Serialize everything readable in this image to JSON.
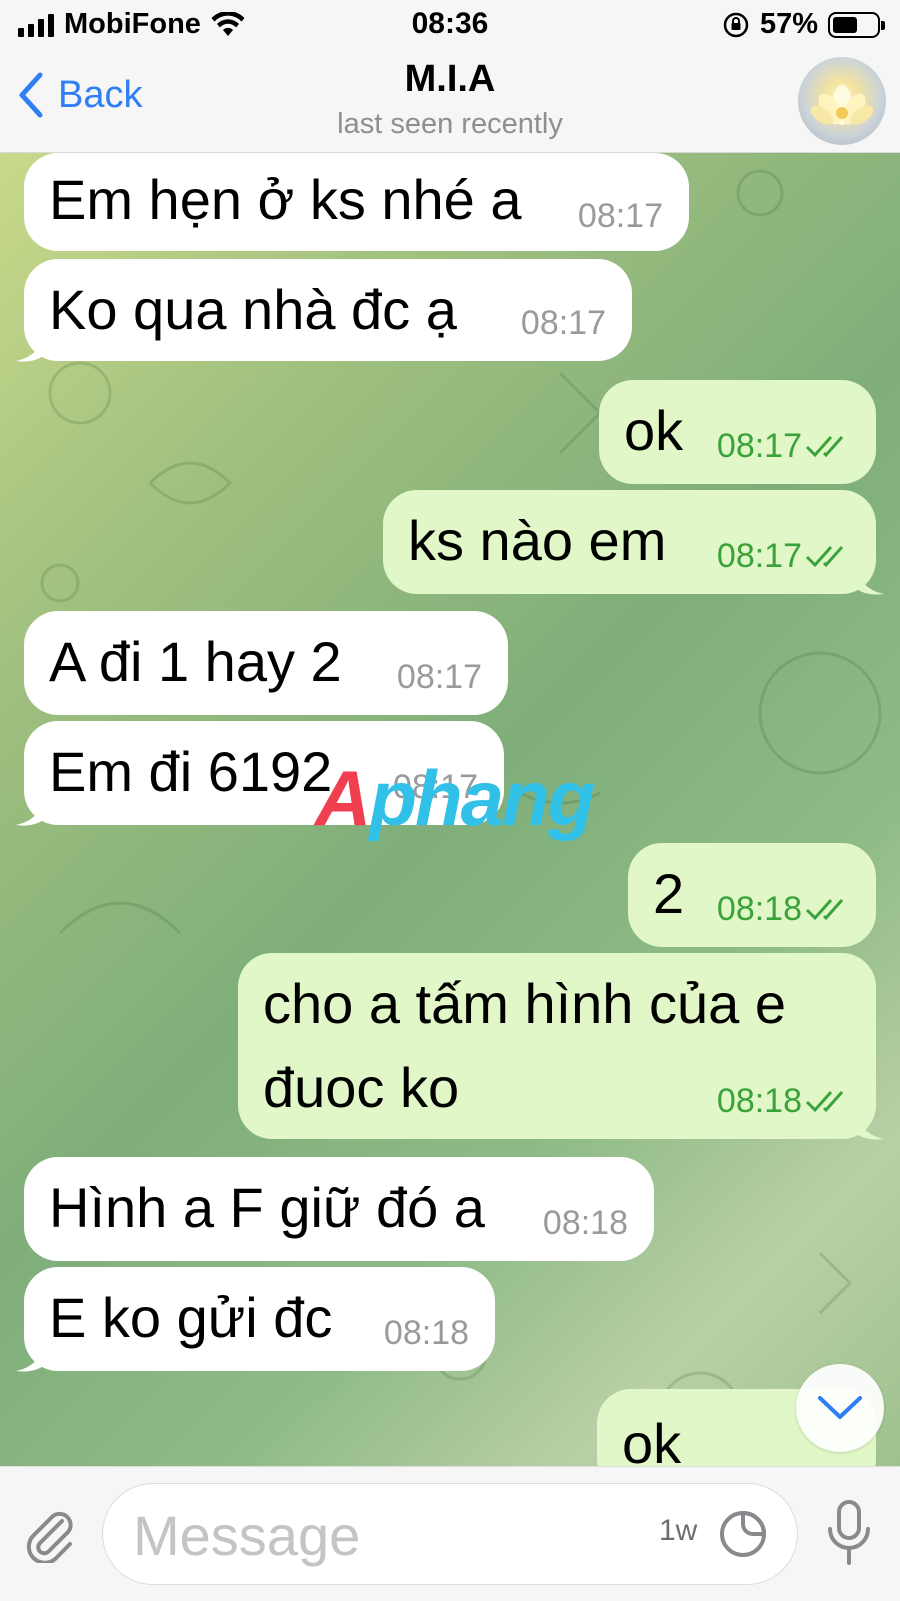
{
  "status_bar": {
    "carrier": "MobiFone",
    "time": "08:36",
    "battery": "57%",
    "battery_level": 0.57
  },
  "header": {
    "back_label": "Back",
    "title": "M.I.A",
    "subtitle": "last seen recently"
  },
  "messages": [
    {
      "dir": "in",
      "text": "Em hẹn ở ks nhé a",
      "time": "08:17"
    },
    {
      "dir": "in",
      "text": "Ko qua nhà đc ạ",
      "time": "08:17"
    },
    {
      "dir": "out",
      "text": "ok",
      "time": "08:17",
      "status": "read"
    },
    {
      "dir": "out",
      "text": "ks nào em",
      "time": "08:17",
      "status": "read"
    },
    {
      "dir": "in",
      "text": "A đi 1 hay 2",
      "time": "08:17"
    },
    {
      "dir": "in",
      "text": "Em đi 6192",
      "time": "08:17"
    },
    {
      "dir": "out",
      "text": "2",
      "time": "08:18",
      "status": "read"
    },
    {
      "dir": "out",
      "text_line1": "cho a tấm hình của e",
      "text_line2": "đuoc ko",
      "time": "08:18",
      "status": "read"
    },
    {
      "dir": "in",
      "text": "Hình a F giữ đó a",
      "time": "08:18"
    },
    {
      "dir": "in",
      "text": "E ko gửi đc",
      "time": "08:18"
    },
    {
      "dir": "out",
      "text": "ok",
      "time": "",
      "status": "read"
    }
  ],
  "watermark": {
    "part1": "A",
    "part2": "phang"
  },
  "input": {
    "placeholder": "Message",
    "value": "",
    "timer_label": "1w"
  },
  "icons": [
    "back-chevron-icon",
    "paperclip-icon",
    "sticker-icon",
    "microphone-icon",
    "chevron-down-icon",
    "double-check-icon"
  ],
  "colors": {
    "accent": "#2f7ef5",
    "outgoing_bubble": "#e1f7c7",
    "incoming_bubble": "#ffffff",
    "read_check": "#3aa23a"
  }
}
